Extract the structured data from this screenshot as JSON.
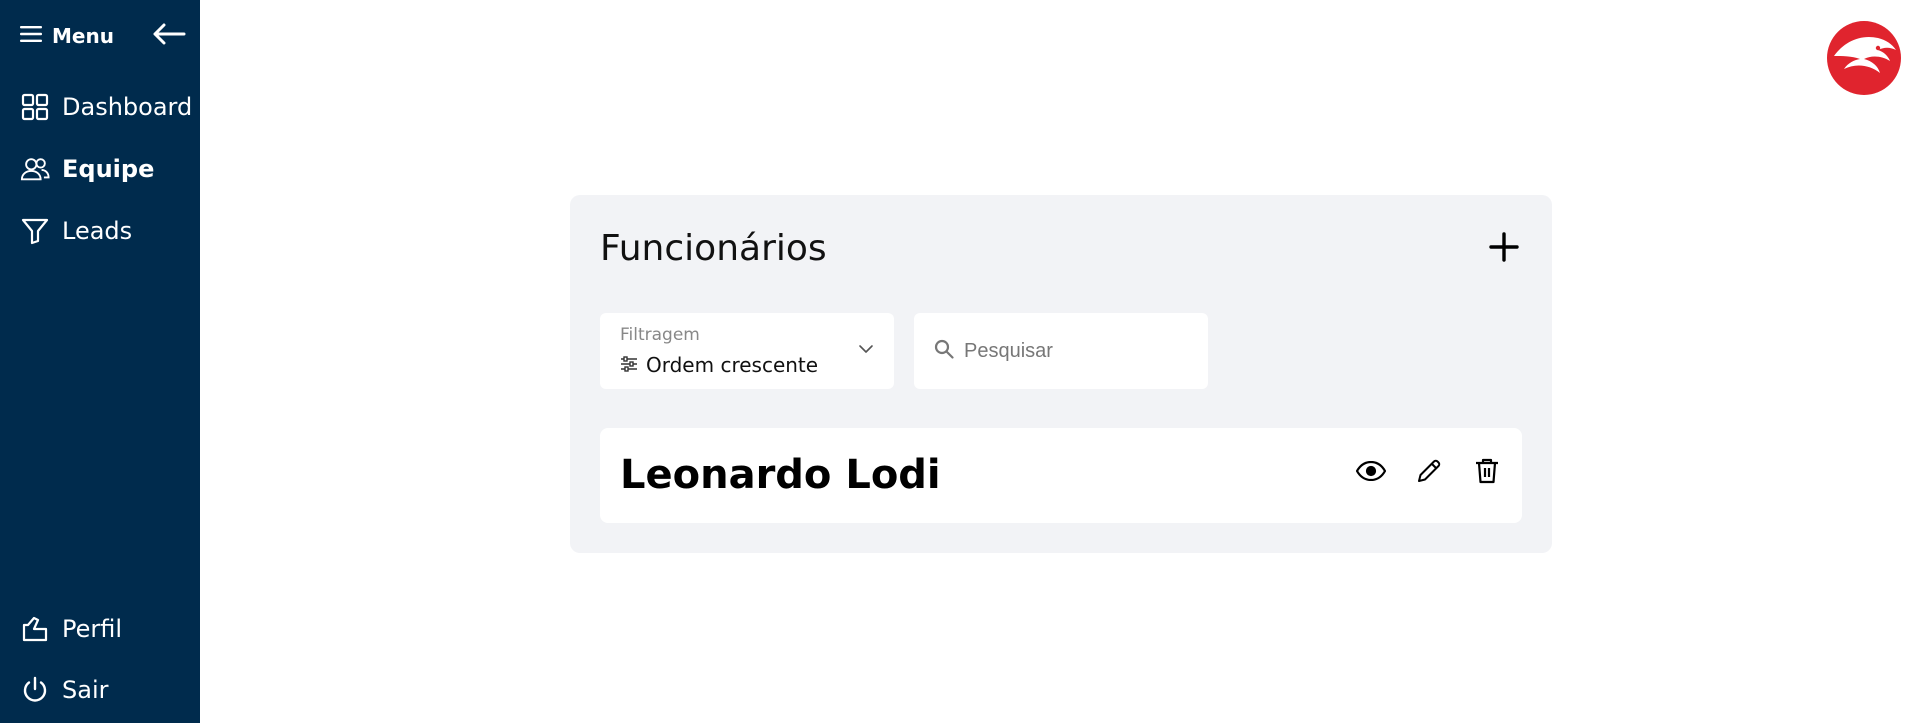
{
  "sidebar": {
    "menu_label": "Menu",
    "items": [
      {
        "label": "Dashboard",
        "icon": "grid-icon"
      },
      {
        "label": "Equipe",
        "icon": "users-icon",
        "active": true
      },
      {
        "label": "Leads",
        "icon": "filter-icon"
      }
    ],
    "bottom_items": [
      {
        "label": "Perfil",
        "icon": "profile-icon"
      },
      {
        "label": "Sair",
        "icon": "power-icon"
      }
    ]
  },
  "colors": {
    "sidebar_bg": "#002b4d",
    "card_bg": "#f2f3f6",
    "brand_red": "#e0242e"
  },
  "card": {
    "title": "Funcionários",
    "filter": {
      "label": "Filtragem",
      "value": "Ordem crescente"
    },
    "search": {
      "placeholder": "Pesquisar"
    },
    "employees": [
      {
        "name": "Leonardo Lodi",
        "actions": [
          "eye-icon",
          "pencil-icon",
          "trash-icon"
        ]
      }
    ]
  }
}
